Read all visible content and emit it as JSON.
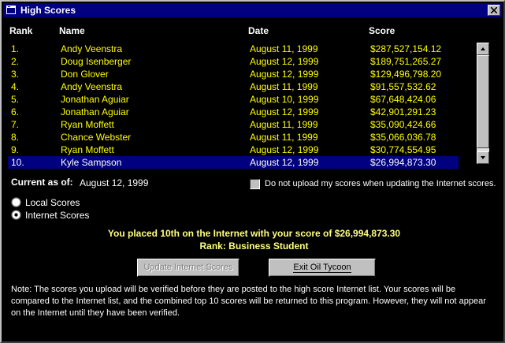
{
  "window": {
    "title": "High Scores"
  },
  "columns": {
    "rank": "Rank",
    "name": "Name",
    "date": "Date",
    "score": "Score"
  },
  "rows": [
    {
      "rank": "1.",
      "name": "Andy Veenstra",
      "date": "August 11, 1999",
      "score": "$287,527,154.12"
    },
    {
      "rank": "2.",
      "name": "Doug Isenberger",
      "date": "August 12, 1999",
      "score": "$189,751,265.27"
    },
    {
      "rank": "3.",
      "name": "Don Glover",
      "date": "August 12, 1999",
      "score": "$129,496,798.20"
    },
    {
      "rank": "4.",
      "name": "Andy Veenstra",
      "date": "August 11, 1999",
      "score": "$91,557,532.62"
    },
    {
      "rank": "5.",
      "name": "Jonathan Aguiar",
      "date": "August 10, 1999",
      "score": "$67,648,424.06"
    },
    {
      "rank": "6.",
      "name": "Jonathan Aguiar",
      "date": "August 12, 1999",
      "score": "$42,901,291.23"
    },
    {
      "rank": "7.",
      "name": "Ryan Moffett",
      "date": "August 11, 1999",
      "score": "$35,090,424.66"
    },
    {
      "rank": "8.",
      "name": "Chance Webster",
      "date": "August 11, 1999",
      "score": "$35,066,036.78"
    },
    {
      "rank": "9.",
      "name": "Ryan Moffett",
      "date": "August 12, 1999",
      "score": "$30,774,554.95"
    },
    {
      "rank": "10.",
      "name": "Kyle Sampson",
      "date": "August 12, 1999",
      "score": "$26,994,873.30"
    }
  ],
  "current": {
    "label": "Current as of:",
    "date": "August 12, 1999"
  },
  "upload_checkbox": {
    "label": "Do not upload my scores when updating the Internet scores.",
    "checked": false
  },
  "radios": [
    {
      "label": "Local Scores",
      "selected": false
    },
    {
      "label": "Internet Scores",
      "selected": true
    }
  ],
  "result": {
    "line1": "You placed 10th on the Internet with your score of $26,994,873.30",
    "line2": "Rank:  Business Student"
  },
  "buttons": {
    "update": "Update Internet Scores",
    "exit": "Exit Oil Tycoon"
  },
  "note": "Note:  The scores you upload will be verified before they are posted to the high score Internet list. Your scores will be compared to the Internet list, and the combined top 10 scores will be returned to this program.  However, they will not appear on the Internet until they have been verified.",
  "colors": {
    "title_bar": "#000080",
    "row_text": "#ffff00",
    "selection": "#000080",
    "message_text": "#ffff80"
  }
}
